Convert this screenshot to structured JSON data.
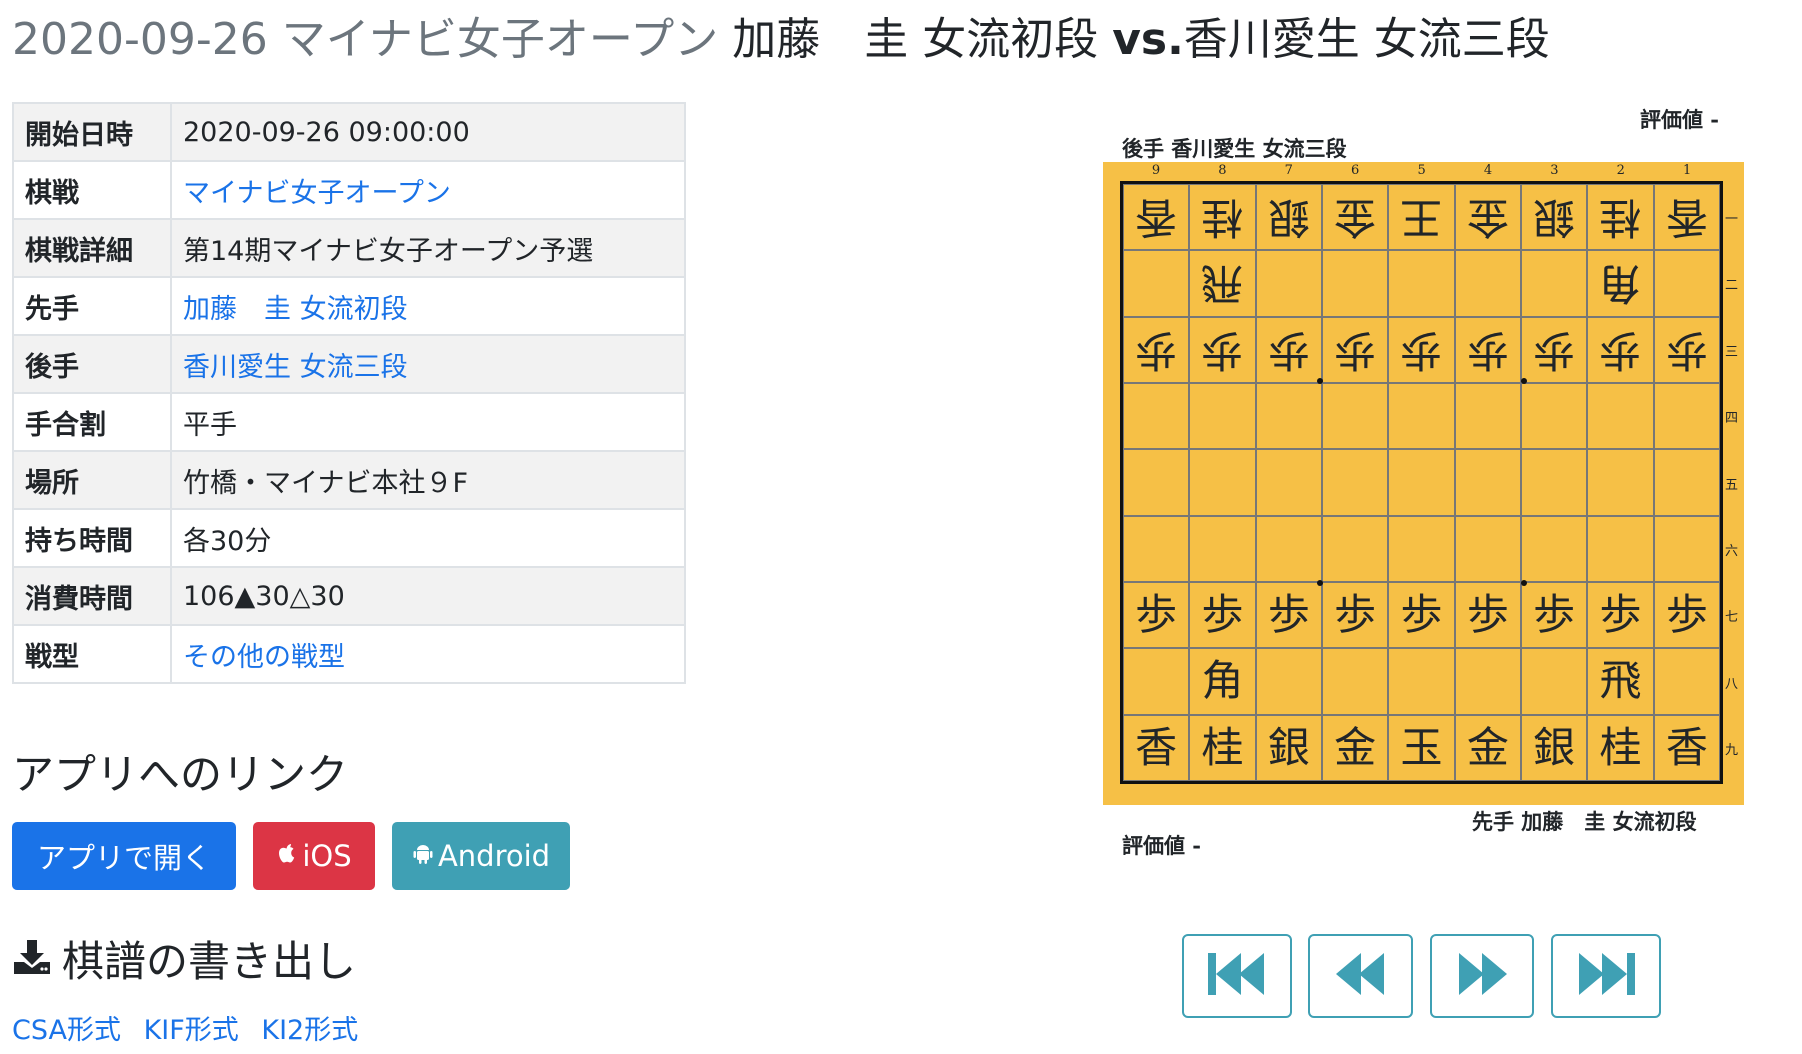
{
  "title": {
    "date": "2020-09-26",
    "tournament": "マイナビ女子オープン",
    "sente": "加藤　圭 女流初段",
    "vs": "vs.",
    "gote": "香川愛生 女流三段"
  },
  "info": [
    {
      "key": "開始日時",
      "value": "2020-09-26 09:00:00",
      "link": false
    },
    {
      "key": "棋戦",
      "value": "マイナビ女子オープン",
      "link": true
    },
    {
      "key": "棋戦詳細",
      "value": "第14期マイナビ女子オープン予選",
      "link": false
    },
    {
      "key": "先手",
      "value": "加藤　圭 女流初段",
      "link": true
    },
    {
      "key": "後手",
      "value": "香川愛生 女流三段",
      "link": true
    },
    {
      "key": "手合割",
      "value": "平手",
      "link": false
    },
    {
      "key": "場所",
      "value": "竹橋・マイナビ本社９F",
      "link": false
    },
    {
      "key": "持ち時間",
      "value": "各30分",
      "link": false
    },
    {
      "key": "消費時間",
      "value": "106▲30△30",
      "link": false
    },
    {
      "key": "戦型",
      "value": "その他の戦型",
      "link": true
    }
  ],
  "app_section": {
    "heading": "アプリへのリンク",
    "open_label": "アプリで開く",
    "ios_label": "iOS",
    "android_label": "Android"
  },
  "export_section": {
    "heading": "棋譜の書き出し",
    "csa": "CSA形式",
    "kif": "KIF形式",
    "ki2": "KI2形式"
  },
  "board": {
    "eval_top": "評価値 -",
    "eval_bottom": "評価値 -",
    "gote_label": "後手 香川愛生 女流三段",
    "sente_label": "先手 加藤　圭 女流初段",
    "files": [
      "9",
      "8",
      "7",
      "6",
      "5",
      "4",
      "3",
      "2",
      "1"
    ],
    "ranks": [
      "一",
      "二",
      "三",
      "四",
      "五",
      "六",
      "七",
      "八",
      "九"
    ],
    "rows": [
      [
        [
          "香",
          1
        ],
        [
          "桂",
          1
        ],
        [
          "銀",
          1
        ],
        [
          "金",
          1
        ],
        [
          "王",
          1
        ],
        [
          "金",
          1
        ],
        [
          "銀",
          1
        ],
        [
          "桂",
          1
        ],
        [
          "香",
          1
        ]
      ],
      [
        [
          "",
          0
        ],
        [
          "飛",
          1
        ],
        [
          "",
          0
        ],
        [
          "",
          0
        ],
        [
          "",
          0
        ],
        [
          "",
          0
        ],
        [
          "",
          0
        ],
        [
          "角",
          1
        ],
        [
          "",
          0
        ]
      ],
      [
        [
          "歩",
          1
        ],
        [
          "歩",
          1
        ],
        [
          "歩",
          1
        ],
        [
          "歩",
          1
        ],
        [
          "歩",
          1
        ],
        [
          "歩",
          1
        ],
        [
          "歩",
          1
        ],
        [
          "歩",
          1
        ],
        [
          "歩",
          1
        ]
      ],
      [
        [
          "",
          0
        ],
        [
          "",
          0
        ],
        [
          "",
          0
        ],
        [
          "",
          0
        ],
        [
          "",
          0
        ],
        [
          "",
          0
        ],
        [
          "",
          0
        ],
        [
          "",
          0
        ],
        [
          "",
          0
        ]
      ],
      [
        [
          "",
          0
        ],
        [
          "",
          0
        ],
        [
          "",
          0
        ],
        [
          "",
          0
        ],
        [
          "",
          0
        ],
        [
          "",
          0
        ],
        [
          "",
          0
        ],
        [
          "",
          0
        ],
        [
          "",
          0
        ]
      ],
      [
        [
          "",
          0
        ],
        [
          "",
          0
        ],
        [
          "",
          0
        ],
        [
          "",
          0
        ],
        [
          "",
          0
        ],
        [
          "",
          0
        ],
        [
          "",
          0
        ],
        [
          "",
          0
        ],
        [
          "",
          0
        ]
      ],
      [
        [
          "歩",
          0
        ],
        [
          "歩",
          0
        ],
        [
          "歩",
          0
        ],
        [
          "歩",
          0
        ],
        [
          "歩",
          0
        ],
        [
          "歩",
          0
        ],
        [
          "歩",
          0
        ],
        [
          "歩",
          0
        ],
        [
          "歩",
          0
        ]
      ],
      [
        [
          "",
          0
        ],
        [
          "角",
          0
        ],
        [
          "",
          0
        ],
        [
          "",
          0
        ],
        [
          "",
          0
        ],
        [
          "",
          0
        ],
        [
          "",
          0
        ],
        [
          "飛",
          0
        ],
        [
          "",
          0
        ]
      ],
      [
        [
          "香",
          0
        ],
        [
          "桂",
          0
        ],
        [
          "銀",
          0
        ],
        [
          "金",
          0
        ],
        [
          "玉",
          0
        ],
        [
          "金",
          0
        ],
        [
          "銀",
          0
        ],
        [
          "桂",
          0
        ],
        [
          "香",
          0
        ]
      ]
    ]
  },
  "colors": {
    "link": "#1a73e8",
    "ios": "#dc3545",
    "android": "#3fa0b4",
    "board": "#f6c046",
    "nav_border": "#3fa0b4"
  },
  "nav_buttons": [
    "first-icon",
    "prev-icon",
    "next-icon",
    "last-icon"
  ]
}
